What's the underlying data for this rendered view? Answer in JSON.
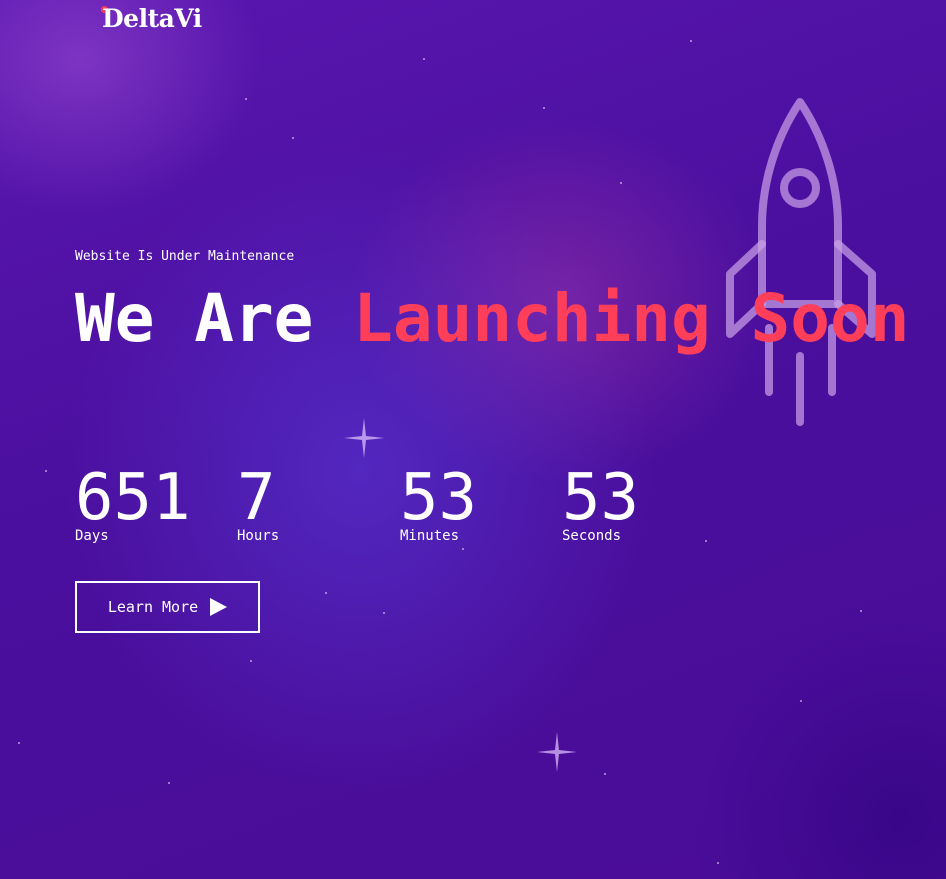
{
  "brand": {
    "name": "DeltaVi",
    "accent_color": "#ff3f5a"
  },
  "hero": {
    "eyebrow": "Website Is Under Maintenance",
    "headline_white": "We Are ",
    "headline_accent": "Launching Soon",
    "decorative_icon": "rocket-icon"
  },
  "countdown": {
    "days": {
      "value": "651",
      "label": "Days"
    },
    "hours": {
      "value": "7",
      "label": "Hours"
    },
    "minutes": {
      "value": "53",
      "label": "Minutes"
    },
    "seconds": {
      "value": "53",
      "label": "Seconds"
    }
  },
  "cta": {
    "label": "Learn More",
    "icon": "play-icon"
  }
}
